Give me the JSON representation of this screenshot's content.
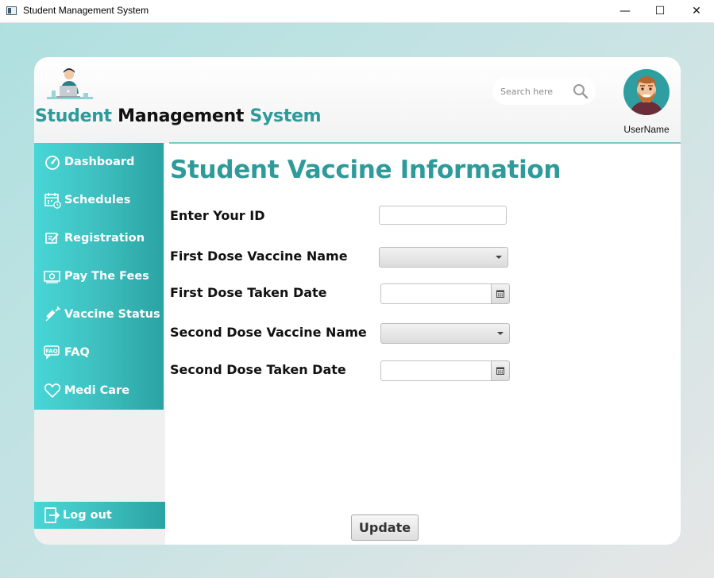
{
  "window": {
    "title": "Student Management System",
    "minimize_glyph": "—",
    "maximize_glyph": "☐",
    "close_glyph": "✕"
  },
  "header": {
    "title_part1": "Student",
    "title_part2": "Management",
    "title_part3": "System",
    "search_placeholder": "Search here",
    "username": "UserName"
  },
  "sidebar": {
    "items": [
      {
        "label": "Dashboard",
        "icon": "speedometer-icon"
      },
      {
        "label": "Schedules",
        "icon": "calendar-icon"
      },
      {
        "label": "Registration",
        "icon": "edit-form-icon"
      },
      {
        "label": "Pay The Fees",
        "icon": "money-icon"
      },
      {
        "label": "Vaccine Status",
        "icon": "syringe-icon"
      },
      {
        "label": "FAQ",
        "icon": "faq-icon"
      },
      {
        "label": "Medi Care",
        "icon": "heart-icon"
      }
    ],
    "logout_label": "Log out"
  },
  "main": {
    "page_title": "Student Vaccine Information",
    "labels": {
      "id": "Enter Your ID",
      "first_name": "First Dose Vaccine Name",
      "first_date": "First Dose Taken Date",
      "second_name": "Second Dose Vaccine Name",
      "second_date": "Second Dose Taken Date"
    },
    "values": {
      "id": "",
      "first_name": "",
      "first_date": "",
      "second_name": "",
      "second_date": ""
    },
    "update_label": "Update"
  },
  "colors": {
    "accent": "#2e9a9a",
    "sidebar_light": "#48d6d6",
    "sidebar_dark": "#2aa3a3"
  }
}
